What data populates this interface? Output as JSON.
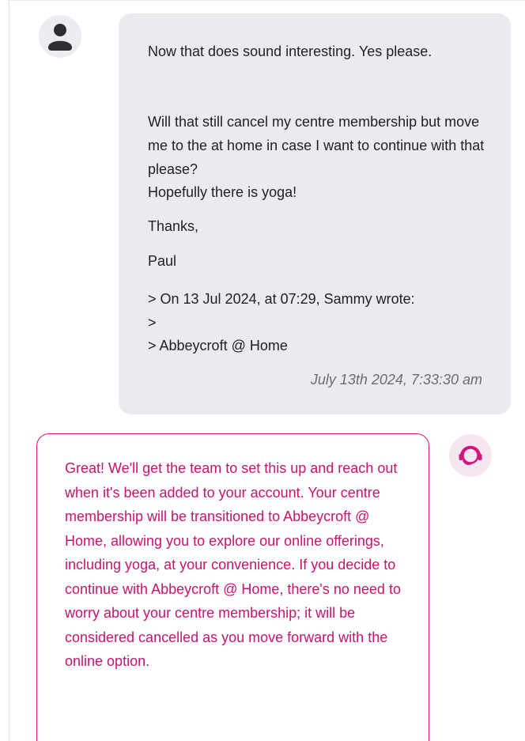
{
  "user_message": {
    "paragraphs": [
      "Now that does sound interesting. Yes please.",
      "Will that still cancel my centre membership but move me to the at home in case I want to continue with that please?",
      "Hopefully there is yoga!",
      "Thanks,",
      "Paul"
    ],
    "quoted": [
      "> On 13 Jul 2024, at 07:29, Sammy wrote:",
      ">",
      "> Abbeycroft @ Home"
    ],
    "timestamp": "July 13th 2024, 7:33:30 am",
    "avatar_icon": "user-silhouette-icon"
  },
  "bot_message": {
    "text": "Great! We'll get the team to set this up and reach out when it's been added to your account. Your centre membership will be transitioned to Abbeycroft @ Home, allowing you to explore our online offerings, including yoga, at your convenience. If you decide to continue with Abbeycroft @ Home, there's no need to worry about your centre membership; it will be considered cancelled as you move forward with the online option.",
    "avatar_icon": "support-agent-icon"
  },
  "colors": {
    "user_bubble": "#ebebef",
    "bot_accent": "#d4157d",
    "bot_text": "#c8136f",
    "text_primary": "#1f1f24",
    "timestamp_text": "#6b6b73"
  }
}
